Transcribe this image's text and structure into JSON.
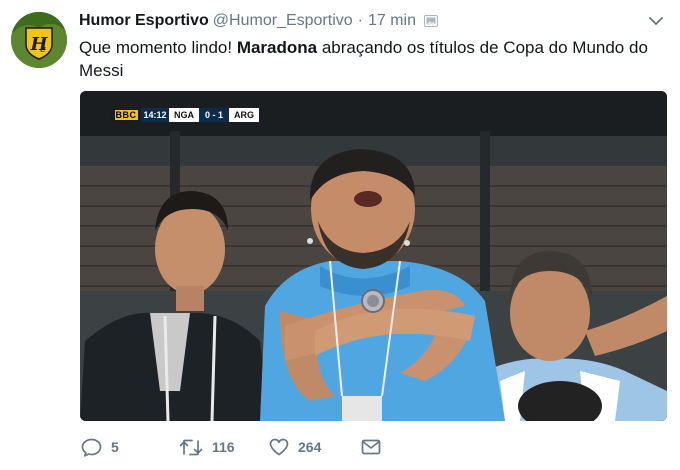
{
  "tweet": {
    "fullname": "Humor Esportivo",
    "username": "@Humor_Esportivo",
    "separator": "·",
    "time": "17 min",
    "text_parts": {
      "before": "Que momento lindo! ",
      "bold": "Maradona",
      "after": " abraçando os títulos de Copa do Mundo do Messi"
    }
  },
  "media": {
    "scorebug": {
      "channel": "BBC",
      "clock": "14:12",
      "home_team": "NGA",
      "score": "0 - 1",
      "away_team": "ARG"
    }
  },
  "actions": {
    "reply_count": "5",
    "retweet_count": "116",
    "like_count": "264"
  },
  "icons": {
    "avatar": "humor-esportivo-logo",
    "verified": "media-attachment-icon",
    "caret": "chevron-down-icon",
    "reply": "reply-icon",
    "retweet": "retweet-icon",
    "like": "heart-icon",
    "dm": "envelope-icon"
  },
  "colors": {
    "secondary_text": "#657786",
    "primary_text": "#14171a",
    "avatar_green": "#5c7f2b",
    "logo_yellow": "#f2c318"
  }
}
